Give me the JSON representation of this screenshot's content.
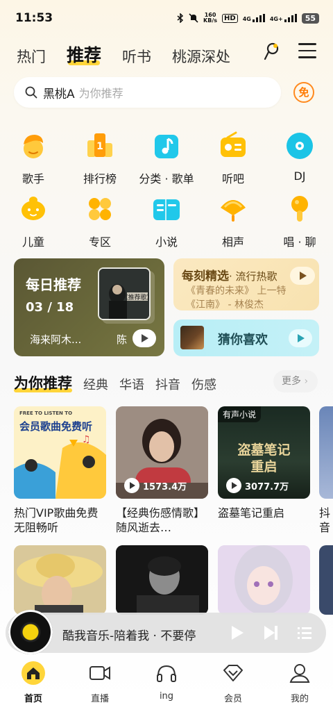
{
  "status_bar": {
    "time": "11:53",
    "net_speed_top": "160",
    "net_speed_bottom": "KB/s",
    "hd_badge": "HD",
    "signal1": "4G",
    "signal2": "4G+",
    "battery": "55"
  },
  "top_tabs": [
    {
      "label": "热门",
      "active": false
    },
    {
      "label": "推荐",
      "active": true
    },
    {
      "label": "听书",
      "active": false
    },
    {
      "label": "桃源深处",
      "active": false
    }
  ],
  "search": {
    "keyword": "黑桃A",
    "placeholder": "为你推荐"
  },
  "free_badge": "免",
  "grid": [
    {
      "label": "歌手",
      "icon": "singer-icon"
    },
    {
      "label": "排行榜",
      "icon": "chart-icon"
    },
    {
      "label": "分类 · 歌单",
      "icon": "playlist-icon"
    },
    {
      "label": "听吧",
      "icon": "radio-icon"
    },
    {
      "label": "DJ",
      "icon": "disc-icon"
    },
    {
      "label": "儿童",
      "icon": "kids-icon"
    },
    {
      "label": "专区",
      "icon": "zone-icon"
    },
    {
      "label": "小说",
      "icon": "book-icon"
    },
    {
      "label": "相声",
      "icon": "fan-icon"
    },
    {
      "label": "唱 · 聊",
      "icon": "karaoke-mic-icon"
    }
  ],
  "daily": {
    "title": "每日推荐",
    "date": "03 / 18",
    "artist": "海来阿木...",
    "artist2": "陈",
    "album_text": "《推荐歌》"
  },
  "moment": {
    "title": "每刻精选",
    "subtitle": "· 流行热歌",
    "line1": "《青春的未来》 上一特",
    "line2": "《江南》 - 林俊杰"
  },
  "guess": {
    "title": "猜你喜欢"
  },
  "section": {
    "tabs": [
      {
        "label": "为你推荐",
        "active": true
      },
      {
        "label": "经典",
        "active": false
      },
      {
        "label": "华语",
        "active": false
      },
      {
        "label": "抖音",
        "active": false
      },
      {
        "label": "伤感",
        "active": false
      }
    ],
    "more": "更多"
  },
  "playlists": [
    {
      "title": "热门VIP歌曲免费无阻畅听",
      "cover_top": "FREE TO LISTEN TO",
      "cover_main": "会员歌曲免费听",
      "count": ""
    },
    {
      "title": "【经典伤感情歌】随风逝去…",
      "count": "1573.4万"
    },
    {
      "title": "盗墓笔记重启",
      "tag": "有声小说",
      "cover_main": "盗墓笔记",
      "cover_sub": "重启",
      "count": "3077.7万"
    },
    {
      "title": "抖音",
      "count": ""
    }
  ],
  "player": {
    "song": "酷我音乐-陪着我 · 不要停"
  },
  "nav": [
    {
      "label": "首页",
      "icon": "home-icon",
      "active": true
    },
    {
      "label": "直播",
      "icon": "live-video-icon",
      "active": false
    },
    {
      "label": "ing",
      "icon": "headphones-icon",
      "active": false
    },
    {
      "label": "会员",
      "icon": "vip-diamond-icon",
      "active": false
    },
    {
      "label": "我的",
      "icon": "profile-icon",
      "active": false
    }
  ],
  "colors": {
    "accent_yellow": "#ffd53a",
    "orange": "#ff8a1f",
    "icon_yellow": "#ffc107",
    "icon_cyan": "#1bc4e6"
  }
}
